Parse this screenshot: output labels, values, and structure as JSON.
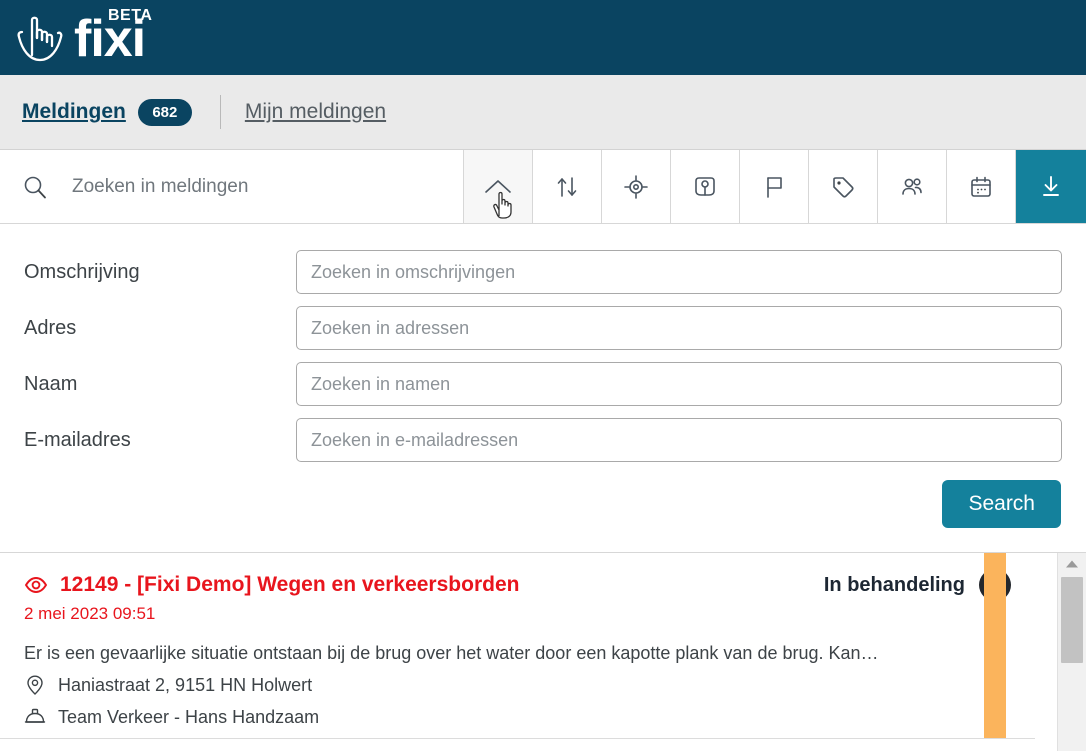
{
  "header": {
    "brand": "fixi",
    "beta_label": "BETA",
    "logo_icon": "hand-pointing-icon",
    "background_color": "#0a4461"
  },
  "navbar": {
    "items": [
      {
        "label": "Meldingen",
        "badge": "682",
        "active": true
      },
      {
        "label": "Mijn meldingen",
        "badge": "",
        "active": false
      }
    ]
  },
  "toolbar": {
    "search_placeholder": "Zoeken in meldingen",
    "search_value": "",
    "buttons": [
      {
        "name": "collapse-filters-button",
        "icon": "chevron-up-icon",
        "state": "active"
      },
      {
        "name": "sort-button",
        "icon": "sort-arrows-icon",
        "state": "default"
      },
      {
        "name": "locate-button",
        "icon": "crosshair-icon",
        "state": "default"
      },
      {
        "name": "area-button",
        "icon": "map-pin-square-icon",
        "state": "default"
      },
      {
        "name": "flag-button",
        "icon": "flag-icon",
        "state": "default"
      },
      {
        "name": "tag-button",
        "icon": "tag-icon",
        "state": "default"
      },
      {
        "name": "assignee-button",
        "icon": "people-icon",
        "state": "default"
      },
      {
        "name": "date-button",
        "icon": "calendar-icon",
        "state": "default"
      },
      {
        "name": "download-button",
        "icon": "download-icon",
        "state": "accent"
      }
    ],
    "accent_color": "#14819c",
    "cursor": "pointing-hand-cursor"
  },
  "filters": {
    "fields": [
      {
        "label": "Omschrijving",
        "placeholder": "Zoeken in omschrijvingen",
        "value": ""
      },
      {
        "label": "Adres",
        "placeholder": "Zoeken in adressen",
        "value": ""
      },
      {
        "label": "Naam",
        "placeholder": "Zoeken in namen",
        "value": ""
      },
      {
        "label": "E-mailadres",
        "placeholder": "Zoeken in e-mailadressen",
        "value": ""
      }
    ],
    "submit_label": "Search"
  },
  "results": {
    "items": [
      {
        "id": "12149",
        "title": "12149 - [Fixi Demo] Wegen en verkeersborden",
        "date": "2 mei 2023 09:51",
        "status": "In behandeling",
        "status_color": "#fbb45c",
        "description": "Er is een gevaarlijke situatie ontstaan bij de brug over het water door een kapotte plank van de brug. Kan…",
        "address": "Haniastraat 2, 9151 HN Holwert",
        "team": "Team Verkeer - Hans Handzaam",
        "title_color": "#e8151d",
        "more_label": "•••"
      }
    ]
  }
}
